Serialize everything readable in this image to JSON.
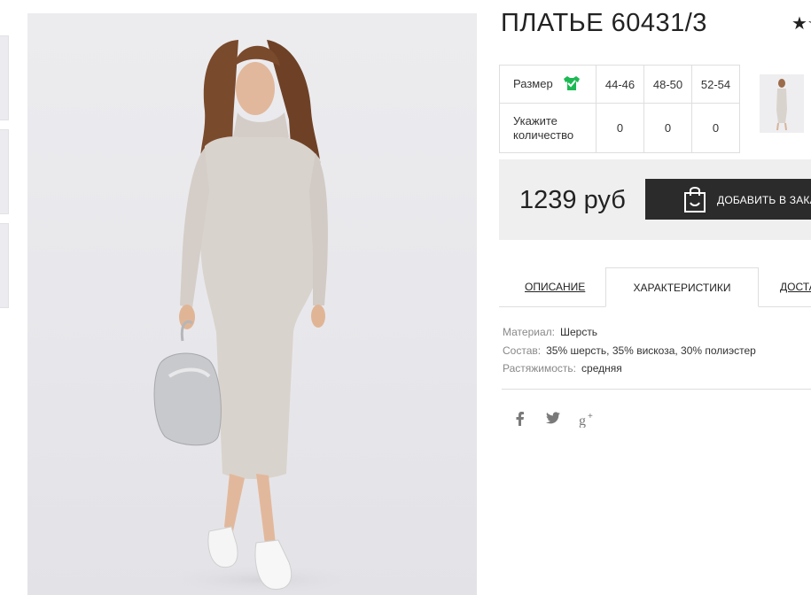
{
  "product": {
    "title": "ПЛАТЬЕ 60431/3",
    "rating_stars": "★☆"
  },
  "size_table": {
    "size_label": "Размер",
    "qty_label": "Укажите количество",
    "sizes": [
      "44-46",
      "48-50",
      "52-54"
    ],
    "quantities": [
      "0",
      "0",
      "0"
    ]
  },
  "price": {
    "value": "1239 руб",
    "add_to_cart_label": "ДОБАВИТЬ В ЗАКАЗ"
  },
  "tabs": [
    {
      "label": "ОПИСАНИЕ",
      "active": false
    },
    {
      "label": "ХАРАКТЕРИСТИКИ",
      "active": true
    },
    {
      "label": "ДОСТАВКА",
      "active": false
    }
  ],
  "specs": [
    {
      "key": "Материал:",
      "value": "Шерсть"
    },
    {
      "key": "Состав:",
      "value": "35% шерсть, 35% вискоза, 30% полиэстер"
    },
    {
      "key": "Растяжимость:",
      "value": "средняя"
    }
  ],
  "social": [
    "facebook-icon",
    "twitter-icon",
    "google-plus-icon"
  ],
  "colors": {
    "accent_green": "#1db954",
    "button_dark": "#2b2b2b",
    "price_bg": "#efefef"
  }
}
